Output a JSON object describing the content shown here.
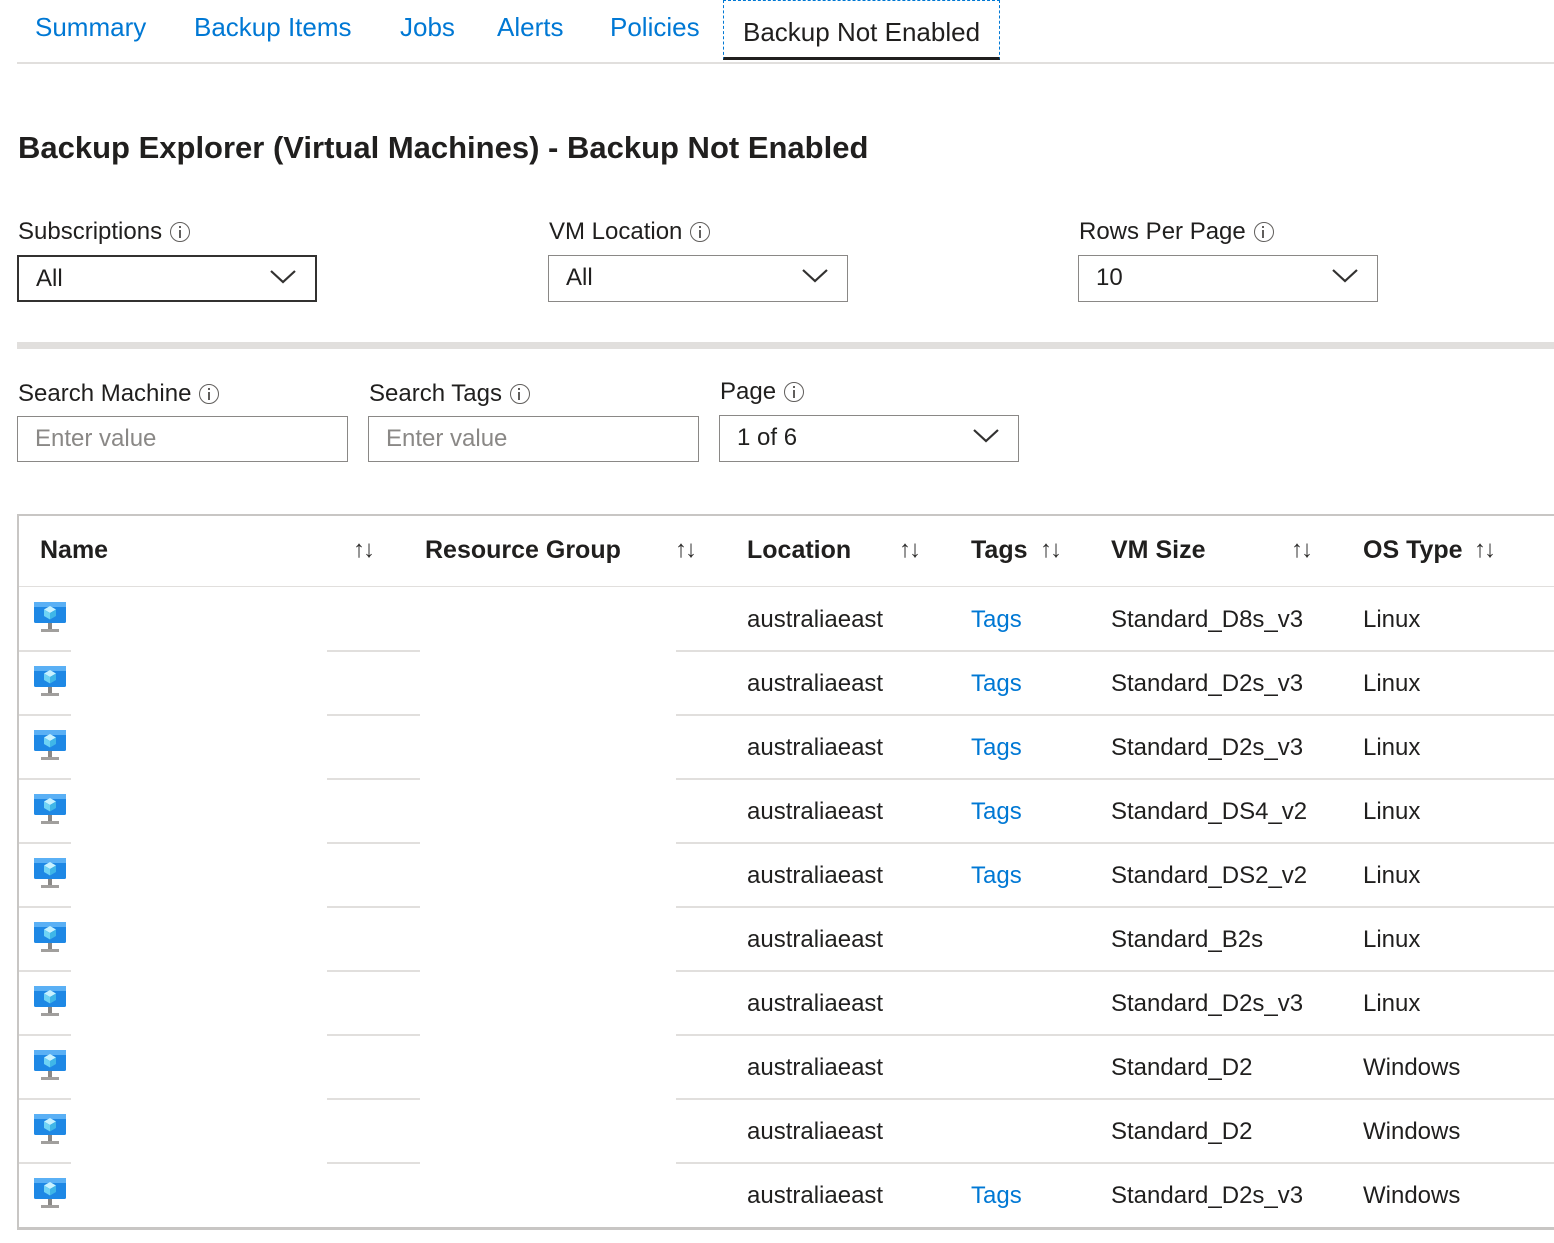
{
  "tabs": [
    {
      "label": "Summary"
    },
    {
      "label": "Backup Items"
    },
    {
      "label": "Jobs"
    },
    {
      "label": "Alerts"
    },
    {
      "label": "Policies"
    },
    {
      "label": "Backup Not Enabled",
      "active": true
    }
  ],
  "title": "Backup Explorer (Virtual Machines) - Backup Not Enabled",
  "filters": {
    "subscriptions": {
      "label": "Subscriptions",
      "value": "All"
    },
    "vm_location": {
      "label": "VM Location",
      "value": "All"
    },
    "rows_per_page": {
      "label": "Rows Per Page",
      "value": "10"
    },
    "search_machine": {
      "label": "Search Machine",
      "placeholder": "Enter value"
    },
    "search_tags": {
      "label": "Search Tags",
      "placeholder": "Enter value"
    },
    "page": {
      "label": "Page",
      "value": "1 of 6"
    }
  },
  "table": {
    "columns": [
      "Name",
      "Resource Group",
      "Location",
      "Tags",
      "VM Size",
      "OS Type"
    ],
    "sort_glyph": "↑↓",
    "rows": [
      {
        "location": "australiaeast",
        "tags": "Tags",
        "vm_size": "Standard_D8s_v3",
        "os_type": "Linux"
      },
      {
        "location": "australiaeast",
        "tags": "Tags",
        "vm_size": "Standard_D2s_v3",
        "os_type": "Linux"
      },
      {
        "location": "australiaeast",
        "tags": "Tags",
        "vm_size": "Standard_D2s_v3",
        "os_type": "Linux"
      },
      {
        "location": "australiaeast",
        "tags": "Tags",
        "vm_size": "Standard_DS4_v2",
        "os_type": "Linux"
      },
      {
        "location": "australiaeast",
        "tags": "Tags",
        "vm_size": "Standard_DS2_v2",
        "os_type": "Linux"
      },
      {
        "location": "australiaeast",
        "tags": "",
        "vm_size": "Standard_B2s",
        "os_type": "Linux"
      },
      {
        "location": "australiaeast",
        "tags": "",
        "vm_size": "Standard_D2s_v3",
        "os_type": "Linux"
      },
      {
        "location": "australiaeast",
        "tags": "",
        "vm_size": "Standard_D2",
        "os_type": "Windows"
      },
      {
        "location": "australiaeast",
        "tags": "",
        "vm_size": "Standard_D2",
        "os_type": "Windows"
      },
      {
        "location": "australiaeast",
        "tags": "Tags",
        "vm_size": "Standard_D2s_v3",
        "os_type": "Windows"
      }
    ]
  },
  "colors": {
    "accent": "#0078d4",
    "text": "#201f1e",
    "border": "#8a8886"
  }
}
